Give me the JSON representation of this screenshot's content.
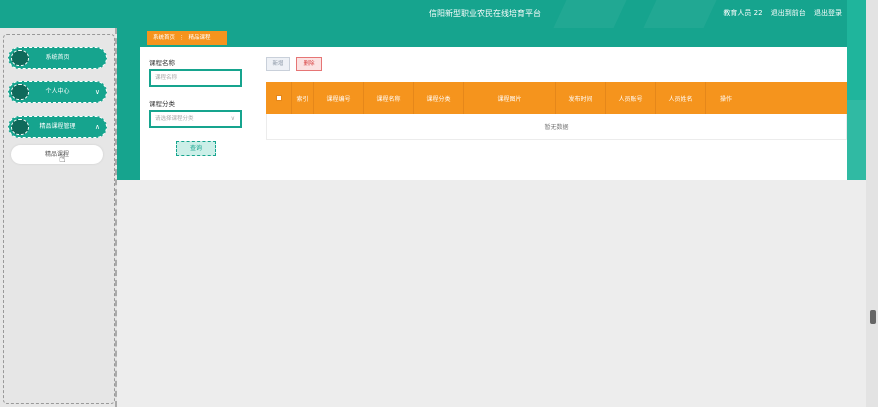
{
  "header": {
    "title": "信阳新型职业农民在线培育平台",
    "user_role": "教育人员 22",
    "back_to_front": "退出到前台",
    "logout": "退出登录"
  },
  "sidebar": {
    "items": [
      {
        "label": "系统首页",
        "has_chevron": false
      },
      {
        "label": "个人中心",
        "has_chevron": true,
        "chevron": "∨"
      },
      {
        "label": "精品课程管理",
        "has_chevron": true,
        "chevron": "∧"
      }
    ],
    "submenu": [
      {
        "label": "精品课程"
      }
    ]
  },
  "breadcrumb": {
    "home": "系统首页",
    "separator": "⋮",
    "current": "精品课程"
  },
  "search": {
    "course_name_label": "课程名称",
    "course_name_placeholder": "课程名称",
    "course_category_label": "课程分类",
    "course_category_placeholder": "请选择课程分类",
    "query_button": "查询"
  },
  "actions": {
    "add": "新增",
    "delete": "删除"
  },
  "table": {
    "columns": [
      "索引",
      "课程编号",
      "课程名称",
      "课程分类",
      "课程图片",
      "发布时间",
      "人员账号",
      "人员姓名",
      "操作"
    ],
    "empty_text": "暂无数据"
  },
  "colors": {
    "primary": "#16a48e",
    "accent": "#f5941d"
  }
}
